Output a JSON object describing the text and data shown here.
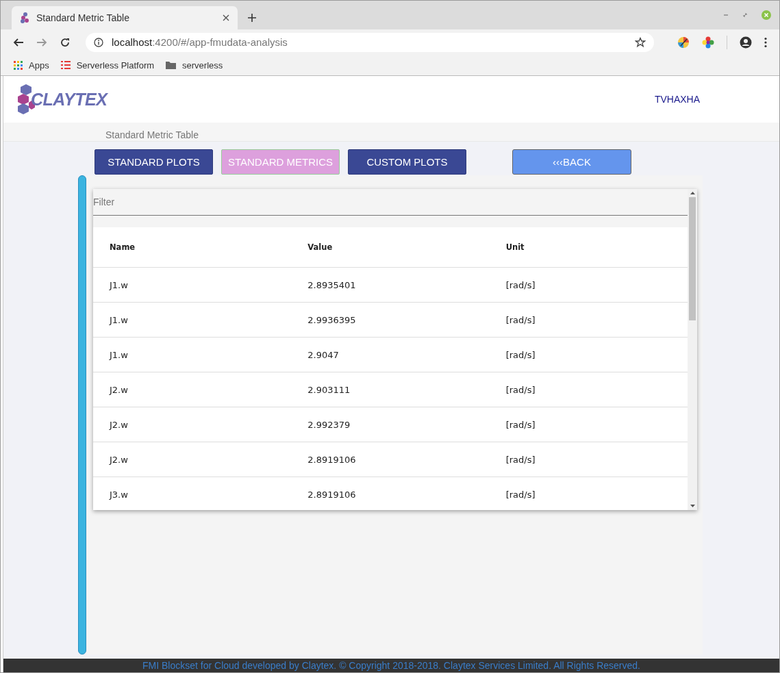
{
  "browser": {
    "tab_title": "Standard Metric Table",
    "url_host": "localhost",
    "url_path": ":4200/#/app-fmudata-analysis",
    "bookmarks": [
      {
        "kind": "apps",
        "label": "Apps"
      },
      {
        "kind": "list",
        "label": "Serverless Platform"
      },
      {
        "kind": "folder",
        "label": "serverless"
      }
    ]
  },
  "header": {
    "logo": "CLAYTEX",
    "user": "TVHAXHA"
  },
  "breadcrumb": "Standard Metric Table",
  "nav_buttons": [
    {
      "label": "STANDARD PLOTS",
      "selected": false
    },
    {
      "label": "STANDARD METRICS",
      "selected": true
    },
    {
      "label": "CUSTOM PLOTS",
      "selected": false
    }
  ],
  "back_button": "‹‹‹BACK",
  "filter": {
    "placeholder": "Filter"
  },
  "table": {
    "columns": [
      "Name",
      "Value",
      "Unit"
    ],
    "rows": [
      [
        "J1.w",
        "2.8935401",
        "[rad/s]"
      ],
      [
        "J1.w",
        "2.9936395",
        "[rad/s]"
      ],
      [
        "J1.w",
        "2.9047",
        "[rad/s]"
      ],
      [
        "J2.w",
        "2.903111",
        "[rad/s]"
      ],
      [
        "J2.w",
        "2.992379",
        "[rad/s]"
      ],
      [
        "J2.w",
        "2.8919106",
        "[rad/s]"
      ],
      [
        "J3.w",
        "2.8919106",
        "[rad/s]"
      ]
    ]
  },
  "footer": "FMI Blockset for Cloud developed by Claytex. © Copyright 2018-2018. Claytex Services Limited. All Rights Reserved."
}
